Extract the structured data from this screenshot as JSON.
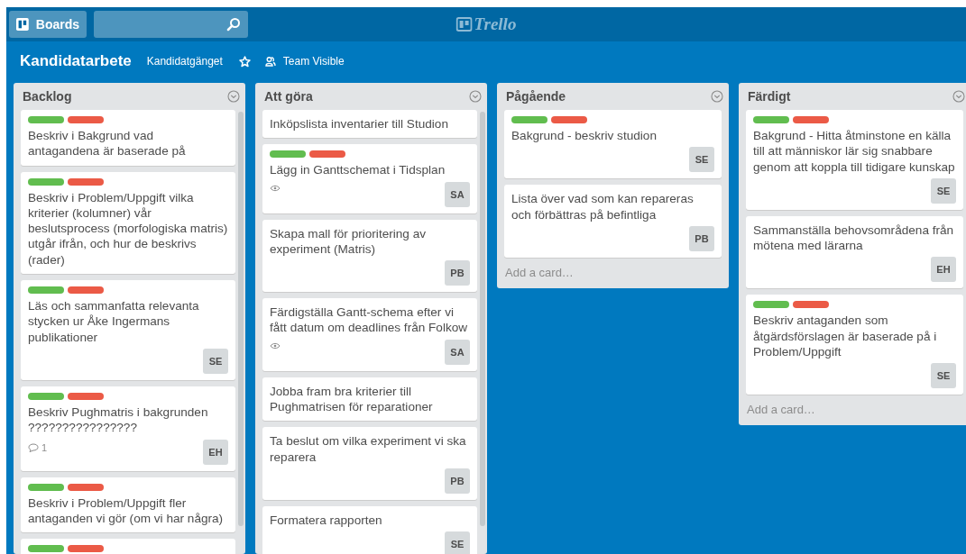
{
  "header": {
    "boards_button": "Boards",
    "logo": "Trello"
  },
  "board": {
    "title": "Kandidatarbete",
    "team": "Kandidatgänget",
    "starred": false,
    "visibility": "Team Visible"
  },
  "lists": [
    {
      "name": "Backlog",
      "scrollable": true,
      "cards": [
        {
          "labels": [
            {
              "color": "#61bd4f"
            },
            {
              "color": "#eb5a46"
            }
          ],
          "title": "Beskriv i Bakgrund vad antagandena är baserade på"
        },
        {
          "labels": [
            {
              "color": "#61bd4f"
            },
            {
              "color": "#eb5a46"
            }
          ],
          "title": "Beskriv i Problem/Uppgift vilka kriterier (kolumner) vår beslutsprocess (morfologiska matris) utgår ifrån, och hur de beskrivs (rader)"
        },
        {
          "labels": [
            {
              "color": "#61bd4f"
            },
            {
              "color": "#eb5a46"
            }
          ],
          "title": "Läs och sammanfatta relevanta stycken ur Åke Ingermans publikationer",
          "members": [
            "SE"
          ]
        },
        {
          "labels": [
            {
              "color": "#61bd4f"
            },
            {
              "color": "#eb5a46"
            }
          ],
          "title": "Beskriv Pughmatris i bakgrunden ????????????????",
          "badges": [
            {
              "kind": "comments",
              "text": "1"
            }
          ],
          "members": [
            "EH"
          ]
        },
        {
          "labels": [
            {
              "color": "#61bd4f"
            },
            {
              "color": "#eb5a46"
            }
          ],
          "title": "Beskriv i Problem/Uppgift fler antaganden vi gör (om vi har några)"
        },
        {
          "labels": [
            {
              "color": "#61bd4f"
            },
            {
              "color": "#eb5a46"
            }
          ]
        }
      ]
    },
    {
      "name": "Att göra",
      "scrollable": true,
      "cards": [
        {
          "title": "Inköpslista inventarier till Studion"
        },
        {
          "labels": [
            {
              "color": "#61bd4f"
            },
            {
              "color": "#eb5a46"
            }
          ],
          "title": "Lägg in Ganttschemat i Tidsplan",
          "badges": [
            {
              "kind": "watch"
            }
          ],
          "members": [
            "SA"
          ]
        },
        {
          "title": "Skapa mall för prioritering av experiment (Matris)",
          "members": [
            "PB"
          ]
        },
        {
          "title": "Färdigställa Gantt-schema efter vi fått datum om deadlines från Folkow",
          "badges": [
            {
              "kind": "watch"
            }
          ],
          "members": [
            "SA"
          ]
        },
        {
          "title": "Jobba fram bra kriterier till Pughmatrisen för reparationer"
        },
        {
          "title": "Ta beslut om vilka experiment vi ska reparera",
          "members": [
            "PB"
          ]
        },
        {
          "title": "Formatera rapporten",
          "members": [
            "SE"
          ]
        }
      ]
    },
    {
      "name": "Pågående",
      "scrollable": false,
      "add_card": "Add a card…",
      "cards": [
        {
          "labels": [
            {
              "color": "#61bd4f"
            },
            {
              "color": "#eb5a46"
            }
          ],
          "title": "Bakgrund - beskriv studion",
          "members": [
            "SE"
          ]
        },
        {
          "title": "Lista över vad som kan repareras och förbättras på befintliga",
          "members": [
            "PB"
          ]
        }
      ]
    },
    {
      "name": "Färdigt",
      "scrollable": false,
      "add_card": "Add a card…",
      "cards": [
        {
          "labels": [
            {
              "color": "#61bd4f"
            },
            {
              "color": "#eb5a46"
            }
          ],
          "title": "Bakgrund - Hitta åtminstone en källa till att människor lär sig snabbare genom att koppla till tidigare kunskap",
          "members": [
            "SE"
          ]
        },
        {
          "title": "Sammanställa behovsområdena från mötena med lärarna",
          "members": [
            "EH"
          ]
        },
        {
          "labels": [
            {
              "color": "#61bd4f"
            },
            {
              "color": "#eb5a46"
            }
          ],
          "title": "Beskriv antaganden som åtgärdsförslagen är baserade på i Problem/Uppgift",
          "members": [
            "SE"
          ]
        }
      ]
    }
  ]
}
